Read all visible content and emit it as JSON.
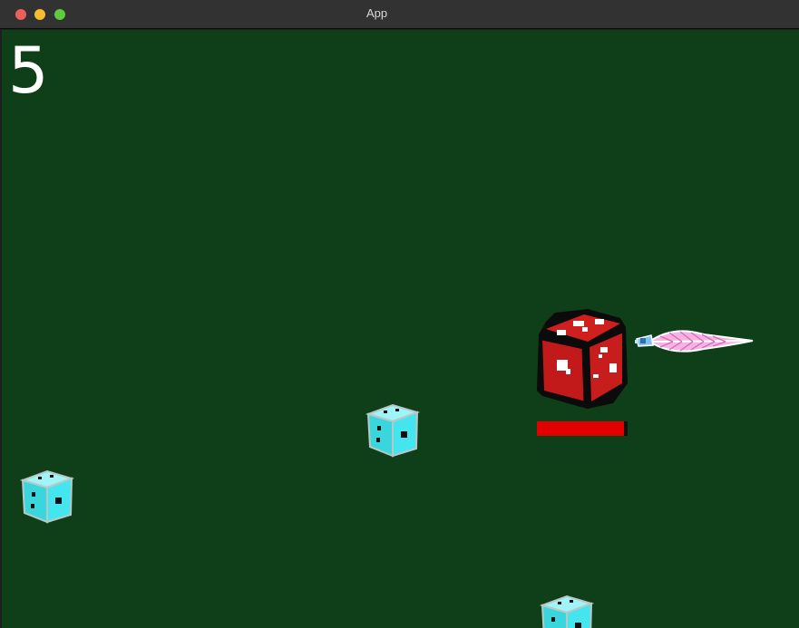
{
  "window": {
    "title": "App",
    "controls": {
      "close_color": "#ed5f57",
      "minimize_color": "#f5be2f",
      "maximize_color": "#5fc93f"
    }
  },
  "game": {
    "background_color": "#0f3f18",
    "score": "5",
    "player": {
      "sprite": "red-die-icon",
      "color": "#c41c1c",
      "health_fraction": 0.96,
      "health_color": "#e00000"
    },
    "projectile": {
      "sprite": "pink-feather-dart-icon",
      "color": "#f3a6dc"
    },
    "enemies": [
      {
        "sprite": "cyan-die-icon",
        "color": "#3fe3ea"
      },
      {
        "sprite": "cyan-die-icon",
        "color": "#3fe3ea"
      },
      {
        "sprite": "cyan-die-icon",
        "color": "#3fe3ea"
      }
    ]
  }
}
